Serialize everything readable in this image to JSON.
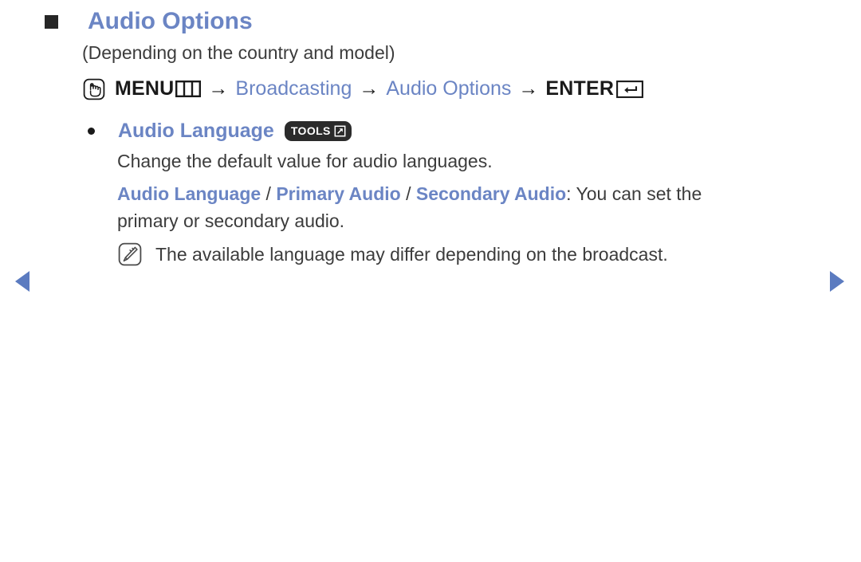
{
  "page": {
    "heading": "Audio Options",
    "sub_caption": "(Depending on the country and model)",
    "accent_color": "#6b85c4",
    "text_color": "#3c3c3c",
    "badge_color": "#2b2b2b"
  },
  "menu_path": {
    "hand_icon": "hand-press-icon",
    "menu_label": "MENU",
    "menu_grid_icon": "menu-grid-icon",
    "arrow": "→",
    "step_broadcasting": "Broadcasting",
    "step_audio_options": "Audio Options",
    "enter_label": "ENTER",
    "enter_icon": "enter-return-icon"
  },
  "item": {
    "bullet_icon": "round-bullet-icon",
    "label": "Audio Language",
    "tools_badge": {
      "text": "TOOLS",
      "icon": "tools-launch-icon"
    },
    "description": "Change the default value for audio languages.",
    "options": {
      "opt1": "Audio Language",
      "sep1": " / ",
      "opt2": "Primary Audio",
      "sep2": " / ",
      "opt3": "Secondary Audio",
      "tail": ": You can set the",
      "line2": "primary or secondary audio."
    },
    "note": {
      "icon": "note-pencil-icon",
      "text": "The available language may differ depending on the broadcast."
    }
  },
  "navigation": {
    "prev_icon": "prev-page-arrow-icon",
    "next_icon": "next-page-arrow-icon"
  }
}
